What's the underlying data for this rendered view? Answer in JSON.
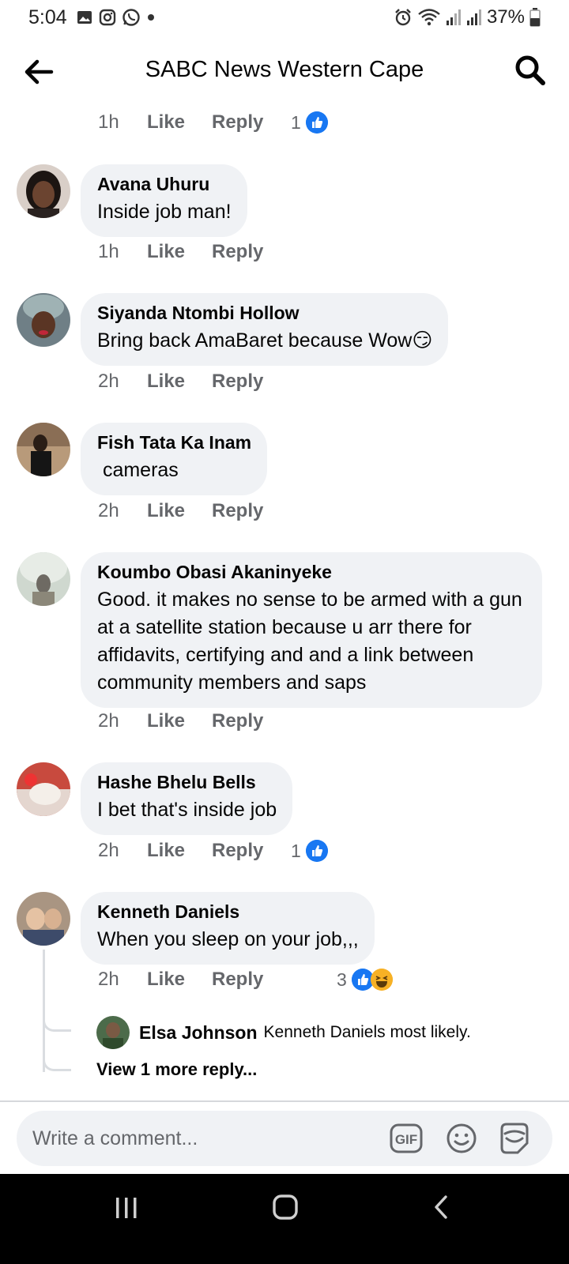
{
  "status_bar": {
    "time": "5:04",
    "battery": "37%",
    "left_icons": [
      "gallery-icon",
      "instagram-icon",
      "whatsapp-icon",
      "dot-icon"
    ],
    "right_icons": [
      "alarm-icon",
      "wifi-icon",
      "signal-icon",
      "signal-icon",
      "battery-icon"
    ]
  },
  "header": {
    "title": "SABC News Western Cape",
    "back_icon": "arrow-left-icon",
    "search_icon": "search-icon"
  },
  "previous_comment_meta": {
    "time": "1h",
    "like": "Like",
    "reply": "Reply",
    "reactions_count": "1"
  },
  "comments": [
    {
      "author": "Avana Uhuru",
      "text": "Inside job man!",
      "time": "1h",
      "like": "Like",
      "reply": "Reply",
      "reactions_count": ""
    },
    {
      "author": "Siyanda Ntombi Hollow",
      "text": "Bring back AmaBaret because Wow😏",
      "time": "2h",
      "like": "Like",
      "reply": "Reply",
      "reactions_count": ""
    },
    {
      "author": "Fish Tata Ka Inam",
      "text": " cameras",
      "time": "2h",
      "like": "Like",
      "reply": "Reply",
      "reactions_count": ""
    },
    {
      "author": "Koumbo Obasi Akaninyeke",
      "text": "Good. it makes no sense to be armed with a gun at a satellite station because u arr there for affidavits, certifying and and a link between community members and saps",
      "time": "2h",
      "like": "Like",
      "reply": "Reply",
      "reactions_count": ""
    },
    {
      "author": "Hashe Bhelu Bells",
      "text": "I bet that's inside job",
      "time": "2h",
      "like": "Like",
      "reply": "Reply",
      "reactions_count": "1"
    },
    {
      "author": "Kenneth Daniels",
      "text": "When you sleep on your job,,,",
      "time": "2h",
      "like": "Like",
      "reply": "Reply",
      "reactions_count": "3"
    }
  ],
  "reply_preview": {
    "author": "Elsa Johnson",
    "text": "Kenneth Daniels most likely.",
    "view_more": "View 1 more reply..."
  },
  "composer": {
    "placeholder": "Write a comment...",
    "gif_label": "GIF",
    "icons": [
      "gif-icon",
      "emoji-icon",
      "sticker-icon"
    ]
  },
  "colors": {
    "bubble": "#f0f2f5",
    "meta_text": "#65676b",
    "like_blue": "#1877f2",
    "haha_yellow": "#f7b125"
  }
}
